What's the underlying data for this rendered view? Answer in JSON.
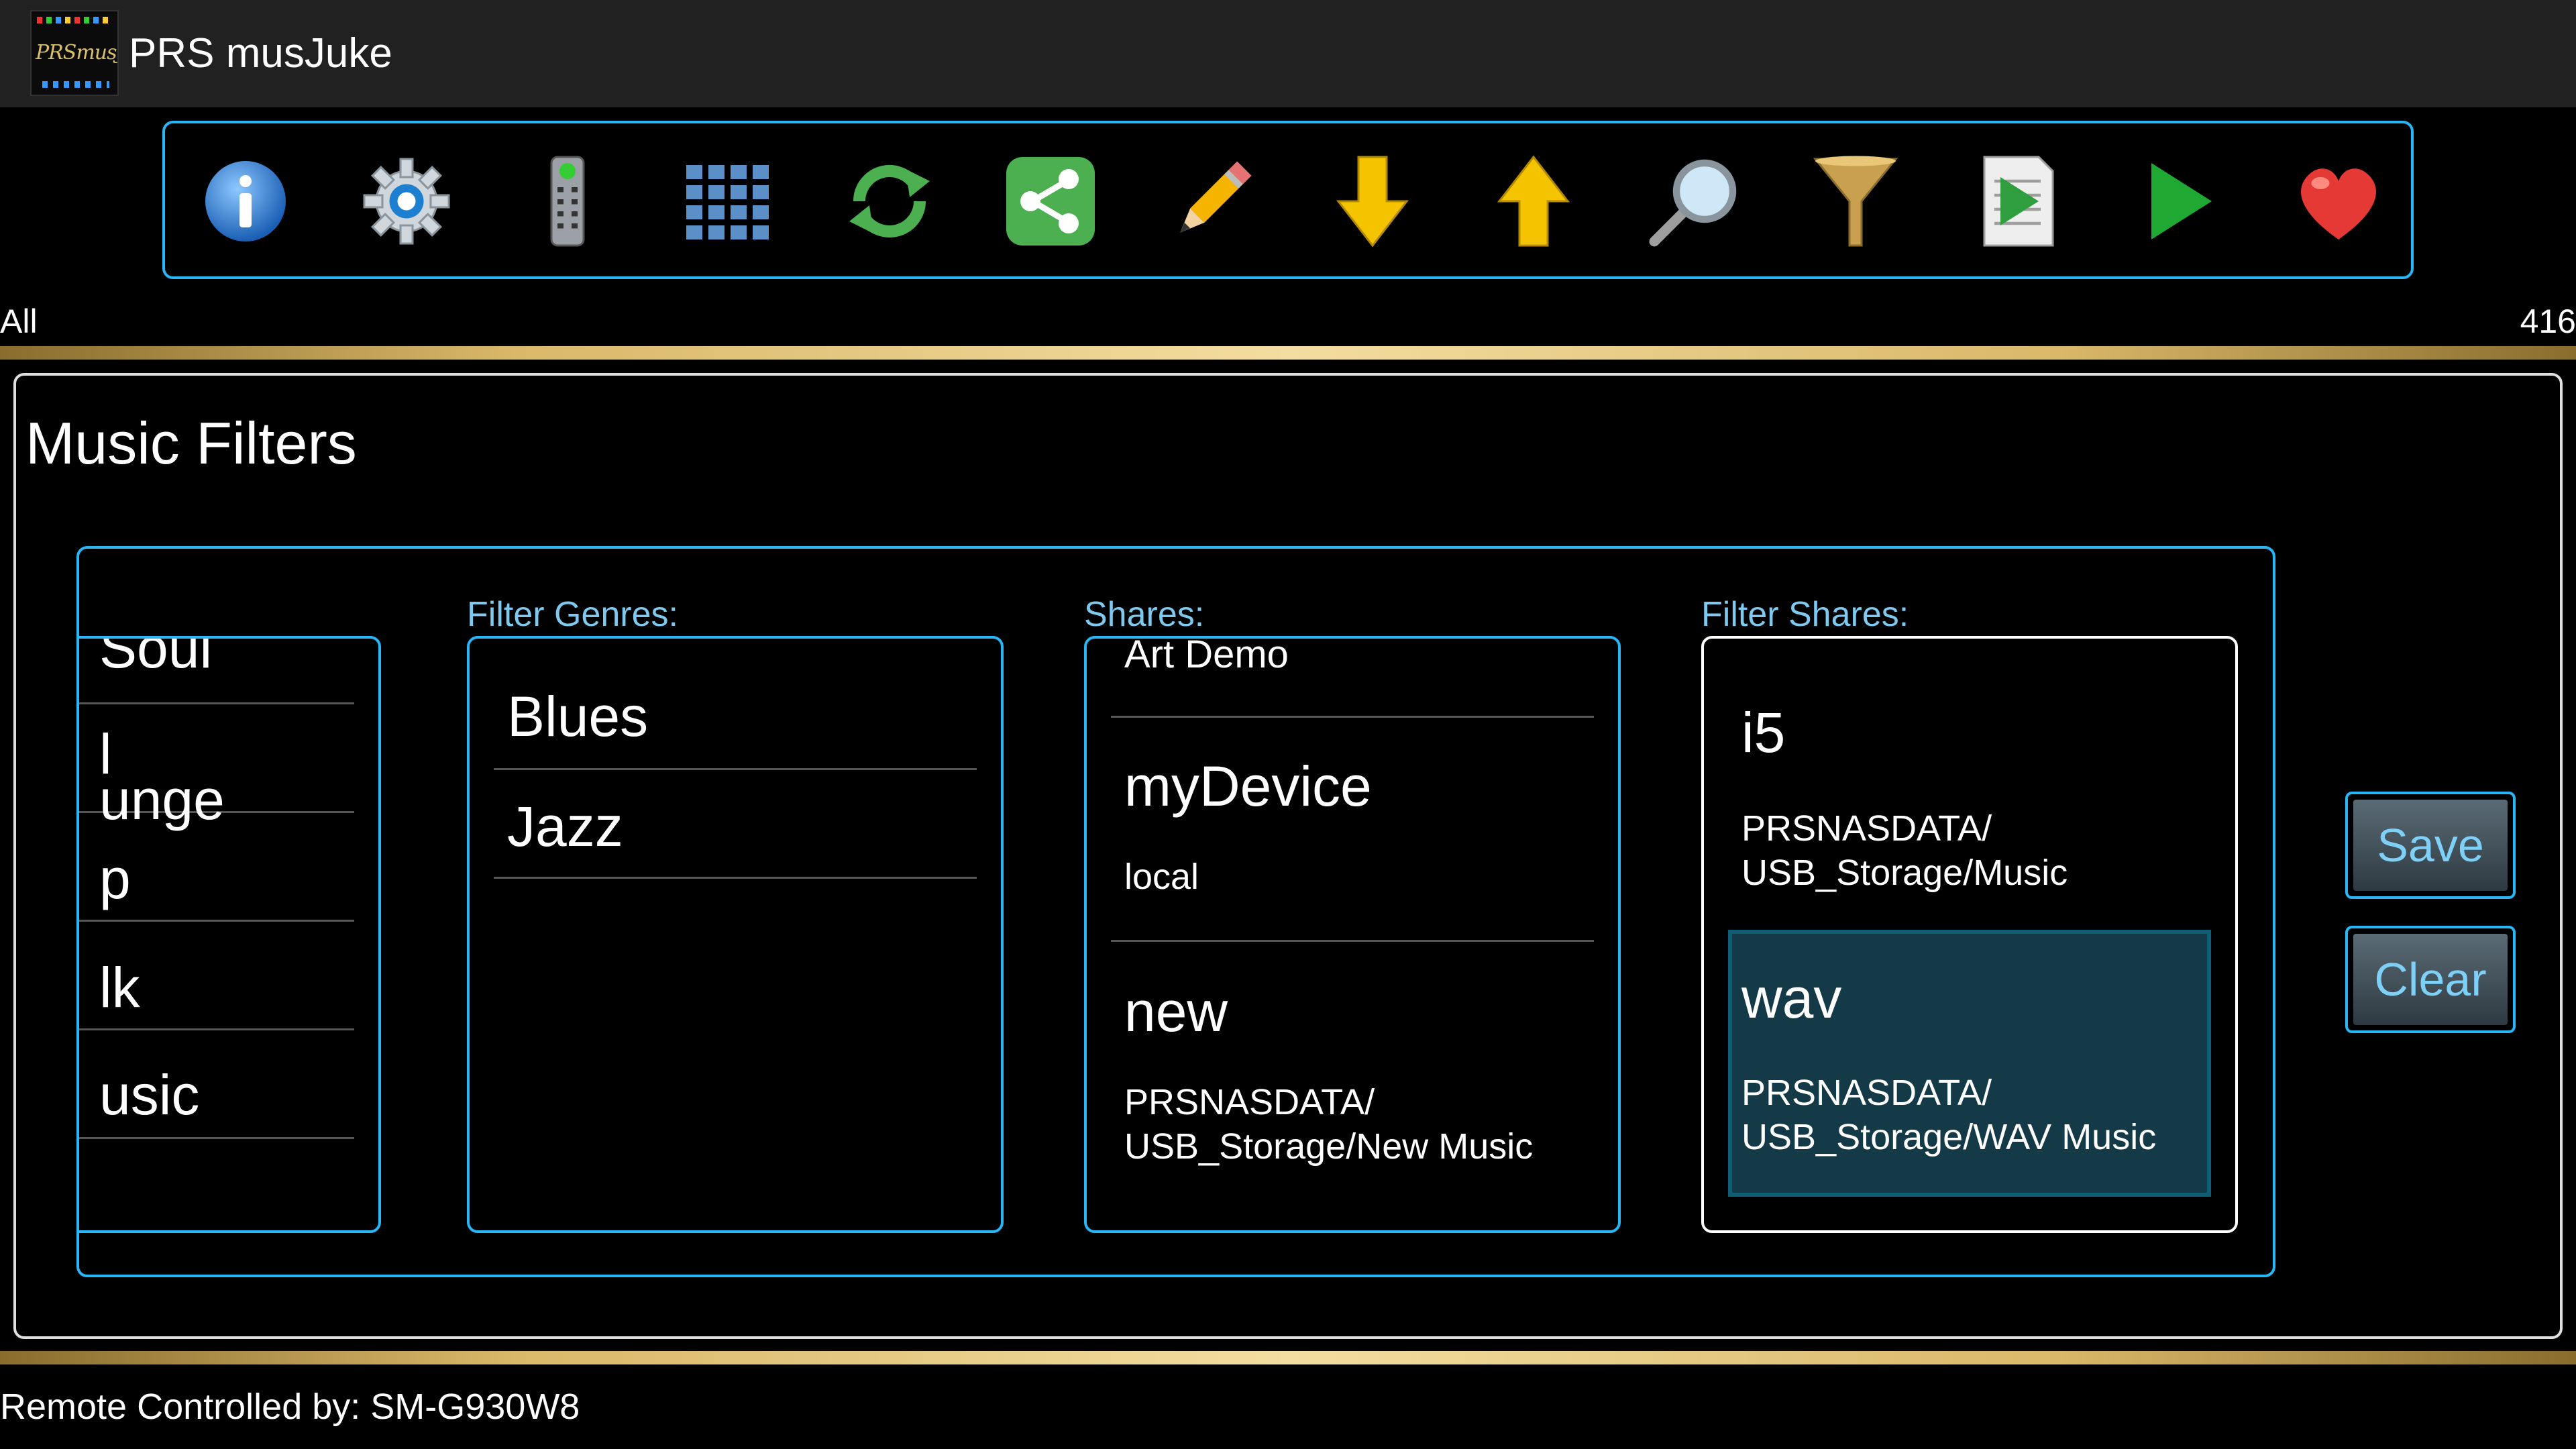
{
  "app": {
    "title": "PRS musJuke",
    "logo_text": "PRSmusJuke"
  },
  "toolbar": {
    "icons": [
      "info-icon",
      "settings-gear-icon",
      "remote-control-icon",
      "grid-icon",
      "refresh-icon",
      "share-icon",
      "edit-pencil-icon",
      "arrow-down-icon",
      "arrow-up-icon",
      "search-magnifier-icon",
      "filter-funnel-icon",
      "playlist-icon",
      "play-icon",
      "favorite-heart-icon"
    ]
  },
  "status": {
    "left": "All",
    "right": "416"
  },
  "panel": {
    "title": "Music Filters",
    "genres_clipped": [
      "Soul",
      "l",
      "unge",
      "p",
      "lk",
      "usic"
    ],
    "filter_genres_label": "Filter Genres:",
    "filter_genres": [
      "Blues",
      "Jazz"
    ],
    "shares_label": "Shares:",
    "shares": [
      {
        "name": "Art Demo",
        "path": ""
      },
      {
        "name": "myDevice",
        "path": "local"
      },
      {
        "name": "new",
        "path1": "PRSNASDATA/",
        "path2": "USB_Storage/New Music"
      }
    ],
    "filter_shares_label": "Filter Shares:",
    "filter_shares": [
      {
        "name": "i5",
        "path1": "PRSNASDATA/",
        "path2": "USB_Storage/Music"
      },
      {
        "name": "wav",
        "path1": "PRSNASDATA/",
        "path2": "USB_Storage/WAV Music",
        "selected": true
      }
    ],
    "save_label": "Save",
    "clear_label": "Clear"
  },
  "footer": {
    "text": "Remote Controlled by: SM-G930W8"
  },
  "colors": {
    "accent": "#29b6f6",
    "gold": "#d9b869",
    "selected_bg": "#153a47"
  }
}
